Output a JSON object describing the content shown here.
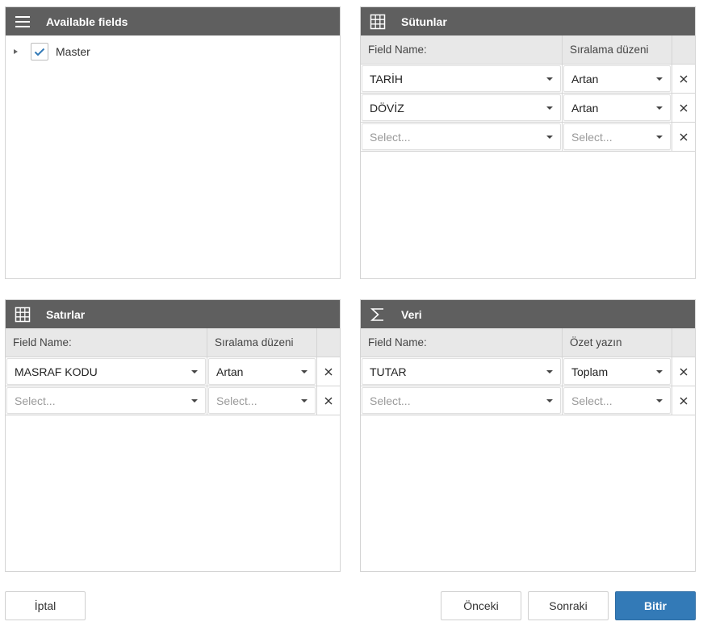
{
  "available_panel": {
    "title": "Available fields",
    "icon": "hamburger-menu-icon",
    "tree": [
      {
        "label": "Master",
        "checked": true,
        "expanded": false
      }
    ]
  },
  "columns_panel": {
    "title": "Sütunlar",
    "icon": "grid-icon",
    "headers": {
      "field": "Field Name:",
      "order": "Sıralama düzeni"
    },
    "rows": [
      {
        "field": "TARİH",
        "order": "Artan"
      },
      {
        "field": "DÖVİZ",
        "order": "Artan"
      },
      {
        "field": "Select...",
        "order": "Select...",
        "placeholder": true
      }
    ]
  },
  "rows_panel": {
    "title": "Satırlar",
    "icon": "grid-icon",
    "headers": {
      "field": "Field Name:",
      "order": "Sıralama düzeni"
    },
    "rows": [
      {
        "field": "MASRAF KODU",
        "order": "Artan"
      },
      {
        "field": "Select...",
        "order": "Select...",
        "placeholder": true
      }
    ]
  },
  "data_panel": {
    "title": "Veri",
    "icon": "sigma-icon",
    "headers": {
      "field": "Field Name:",
      "order": "Özet yazın"
    },
    "rows": [
      {
        "field": "TUTAR",
        "order": "Toplam"
      },
      {
        "field": "Select...",
        "order": "Select...",
        "placeholder": true
      }
    ]
  },
  "footer": {
    "cancel": "İptal",
    "previous": "Önceki",
    "next": "Sonraki",
    "finish": "Bitir"
  },
  "colors": {
    "header_bg": "#5f5f5f",
    "primary_button": "#337ab7",
    "check_color": "#337ab7"
  }
}
